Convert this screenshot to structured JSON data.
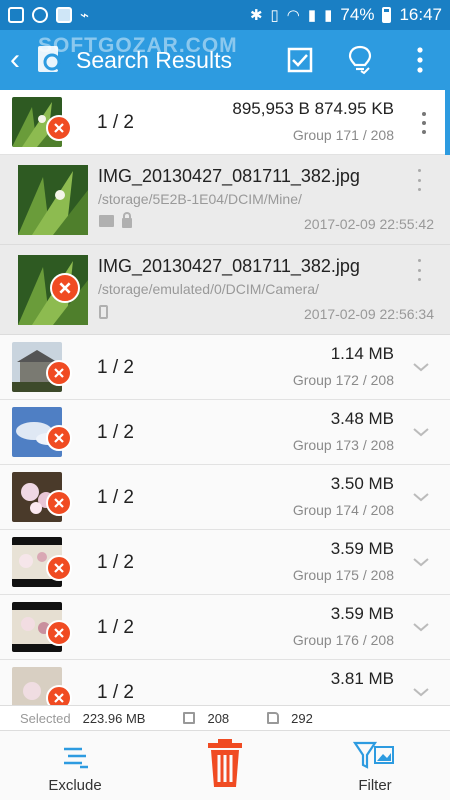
{
  "status_bar": {
    "battery": "74%",
    "time": "16:47"
  },
  "app_bar": {
    "title": "Search Results",
    "watermark": "SOFTGOZAR.COM"
  },
  "groups": [
    {
      "count": "1 / 2",
      "size": "895,953 B   874.95 KB",
      "group": "Group 171 / 208",
      "expanded": true
    },
    {
      "count": "1 / 2",
      "size": "1.14 MB",
      "group": "Group 172 / 208"
    },
    {
      "count": "1 / 2",
      "size": "3.48 MB",
      "group": "Group 173 / 208"
    },
    {
      "count": "1 / 2",
      "size": "3.50 MB",
      "group": "Group 174 / 208"
    },
    {
      "count": "1 / 2",
      "size": "3.59 MB",
      "group": "Group 175 / 208"
    },
    {
      "count": "1 / 2",
      "size": "3.59 MB",
      "group": "Group 176 / 208"
    },
    {
      "count": "1 / 2",
      "size": "3.81 MB",
      "group": ""
    }
  ],
  "files": [
    {
      "name": "IMG_20130427_081711_382.jpg",
      "path": "/storage/5E2B-1E04/DCIM/Mine/",
      "date": "2017-02-09 22:55:42",
      "selected": false
    },
    {
      "name": "IMG_20130427_081711_382.jpg",
      "path": "/storage/emulated/0/DCIM/Camera/",
      "date": "2017-02-09 22:56:34",
      "selected": true
    }
  ],
  "summary": {
    "selected_label": "Selected",
    "selected_size": "223.96 MB",
    "groups": "208",
    "files": "292"
  },
  "bottom_bar": {
    "exclude_label": "Exclude",
    "filter_label": "Filter"
  },
  "colors": {
    "app_bar": "#2d9be0",
    "status_bar": "#1a7fc4",
    "delete_red": "#f04b22"
  }
}
